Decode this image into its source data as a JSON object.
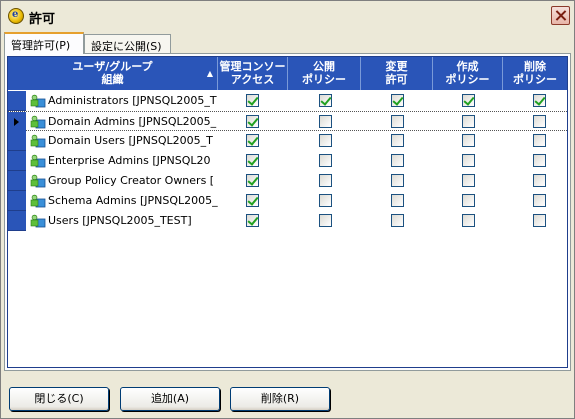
{
  "window": {
    "title": "許可"
  },
  "tabs": [
    {
      "label": "管理許可(P)",
      "active": true
    },
    {
      "label": "設定に公開(S)",
      "active": false
    }
  ],
  "table": {
    "columns": [
      {
        "key": "name",
        "label_line1": "ユーザ/グループ",
        "label_line2": "組織",
        "sort": "▲"
      },
      {
        "key": "console",
        "label_line1": "管理コンソー",
        "label_line2": "アクセス"
      },
      {
        "key": "publish",
        "label_line1": "公開",
        "label_line2": "ポリシー"
      },
      {
        "key": "change",
        "label_line1": "変更",
        "label_line2": "許可"
      },
      {
        "key": "create",
        "label_line1": "作成",
        "label_line2": "ポリシー"
      },
      {
        "key": "delete",
        "label_line1": "削除",
        "label_line2": "ポリシー"
      }
    ],
    "rows": [
      {
        "name": "Administrators [JPNSQL2005_T",
        "console": true,
        "publish": true,
        "change": true,
        "create": true,
        "delete": true,
        "selected": false
      },
      {
        "name": "Domain Admins [JPNSQL2005_",
        "console": true,
        "publish": false,
        "change": false,
        "create": false,
        "delete": false,
        "selected": true
      },
      {
        "name": "Domain Users [JPNSQL2005_T",
        "console": true,
        "publish": false,
        "change": false,
        "create": false,
        "delete": false,
        "selected": false
      },
      {
        "name": "Enterprise Admins [JPNSQL20",
        "console": true,
        "publish": false,
        "change": false,
        "create": false,
        "delete": false,
        "selected": false
      },
      {
        "name": "Group Policy Creator Owners [",
        "console": true,
        "publish": false,
        "change": false,
        "create": false,
        "delete": false,
        "selected": false
      },
      {
        "name": "Schema Admins [JPNSQL2005_",
        "console": true,
        "publish": false,
        "change": false,
        "create": false,
        "delete": false,
        "selected": false
      },
      {
        "name": "Users [JPNSQL2005_TEST]",
        "console": true,
        "publish": false,
        "change": false,
        "create": false,
        "delete": false,
        "selected": false
      }
    ]
  },
  "buttons": {
    "close": "閉じる(C)",
    "add": "追加(A)",
    "delete": "削除(R)"
  },
  "icons": {
    "app": "app-icon",
    "group": "group-icon",
    "close": "close-icon"
  },
  "colors": {
    "header_bg": "#2A55B8",
    "check": "#21A121",
    "tab_highlight": "#E6A02E"
  }
}
